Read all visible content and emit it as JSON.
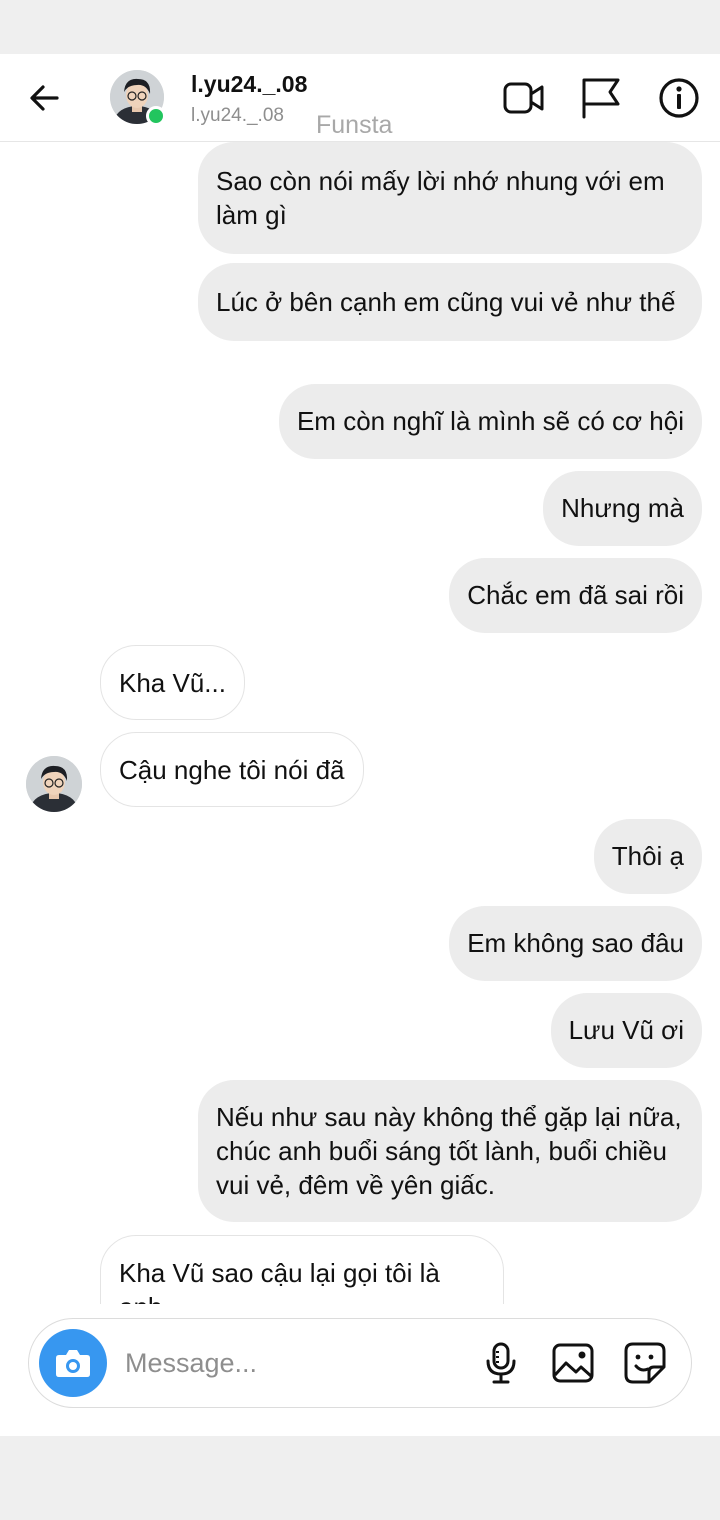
{
  "header": {
    "name": "l.yu24._.08",
    "handle": "l.yu24._.08",
    "account_tag": "Funsta",
    "online_color": "#22c55e",
    "icons": [
      "back-arrow-icon",
      "video-call-icon",
      "flag-icon",
      "info-icon"
    ]
  },
  "messages": [
    {
      "side": "out",
      "text": "Sao còn nói mấy lời nhớ nhung với em làm gì"
    },
    {
      "side": "out",
      "text": "Lúc ở bên cạnh em cũng vui vẻ như thế"
    },
    {
      "side": "out",
      "text": "Em còn nghĩ là mình sẽ có cơ hội"
    },
    {
      "side": "out",
      "text": "Nhưng mà"
    },
    {
      "side": "out",
      "text": "Chắc em đã sai rồi"
    },
    {
      "side": "in",
      "text": "Kha Vũ..."
    },
    {
      "side": "in",
      "text": "Cậu nghe tôi nói đã"
    },
    {
      "side": "out",
      "text": "Thôi ạ"
    },
    {
      "side": "out",
      "text": "Em không sao đâu"
    },
    {
      "side": "out",
      "text": "Lưu Vũ ơi"
    },
    {
      "side": "out",
      "text": "Nếu như sau này không thể gặp lại nữa, chúc anh buổi sáng tốt lành, buổi chiều vui vẻ, đêm về yên giấc."
    },
    {
      "side": "in",
      "text": "Kha Vũ sao cậu lại gọi tôi là anh"
    }
  ],
  "composer": {
    "placeholder": "Message...",
    "accent_color": "#3797f0",
    "icons": [
      "camera-icon",
      "microphone-icon",
      "gallery-icon",
      "sticker-icon"
    ]
  }
}
